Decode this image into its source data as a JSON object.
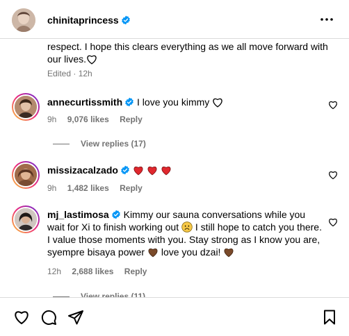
{
  "post": {
    "username": "chinitaprincess",
    "caption_tail": "respect. I hope this clears everything as we all move forward with our lives.",
    "edited": "Edited · 12h"
  },
  "comments": [
    {
      "username": "annecurtissmith",
      "text": "I love you kimmy",
      "time": "9h",
      "likes": "9,076 likes",
      "reply": "Reply",
      "view_replies": "View replies (17)"
    },
    {
      "username": "missizacalzado",
      "text": "",
      "time": "9h",
      "likes": "1,482 likes",
      "reply": "Reply"
    },
    {
      "username": "mj_lastimosa",
      "text_part1": "Kimmy our sauna conversations while you wait for Xi to finish working out",
      "text_part2": "I still hope to catch you there. I value those moments with you. Stay strong as I know you are, syempre bisaya power",
      "text_part3": "love you dzai!",
      "time": "12h",
      "likes": "2,688 likes",
      "reply": "Reply",
      "view_replies": "View replies (11)"
    }
  ],
  "icons": {
    "more": "more-options-icon",
    "verified": "verified-badge-icon",
    "like": "heart-outline-icon",
    "comment": "comment-icon",
    "share": "share-icon",
    "save": "bookmark-icon"
  },
  "colors": {
    "verified": "#0095f6",
    "secondary_text": "#737373",
    "red_heart": "#e0282e",
    "brown_heart": "#7a4a2a"
  }
}
